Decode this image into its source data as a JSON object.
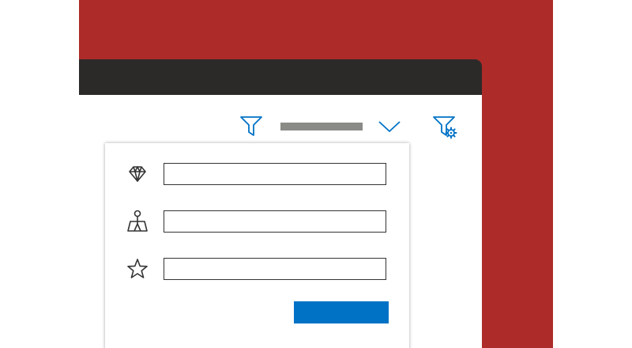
{
  "colors": {
    "background": "#ffffff",
    "panel": "#ad2b29",
    "titlebar": "#2c2a29",
    "accent_blue": "#0072c6",
    "placeholder_bar": "#8a8a86",
    "outline": "#333333"
  },
  "toolbar": {
    "filter_icon": "filter-icon",
    "expand_icon": "chevron-down-icon",
    "filter_settings_icon": "filter-settings-icon"
  },
  "filter_panel": {
    "rows": [
      {
        "icon": "diamond-icon",
        "value": ""
      },
      {
        "icon": "map-pin-icon",
        "value": ""
      },
      {
        "icon": "star-icon",
        "value": ""
      }
    ],
    "apply_label": ""
  }
}
